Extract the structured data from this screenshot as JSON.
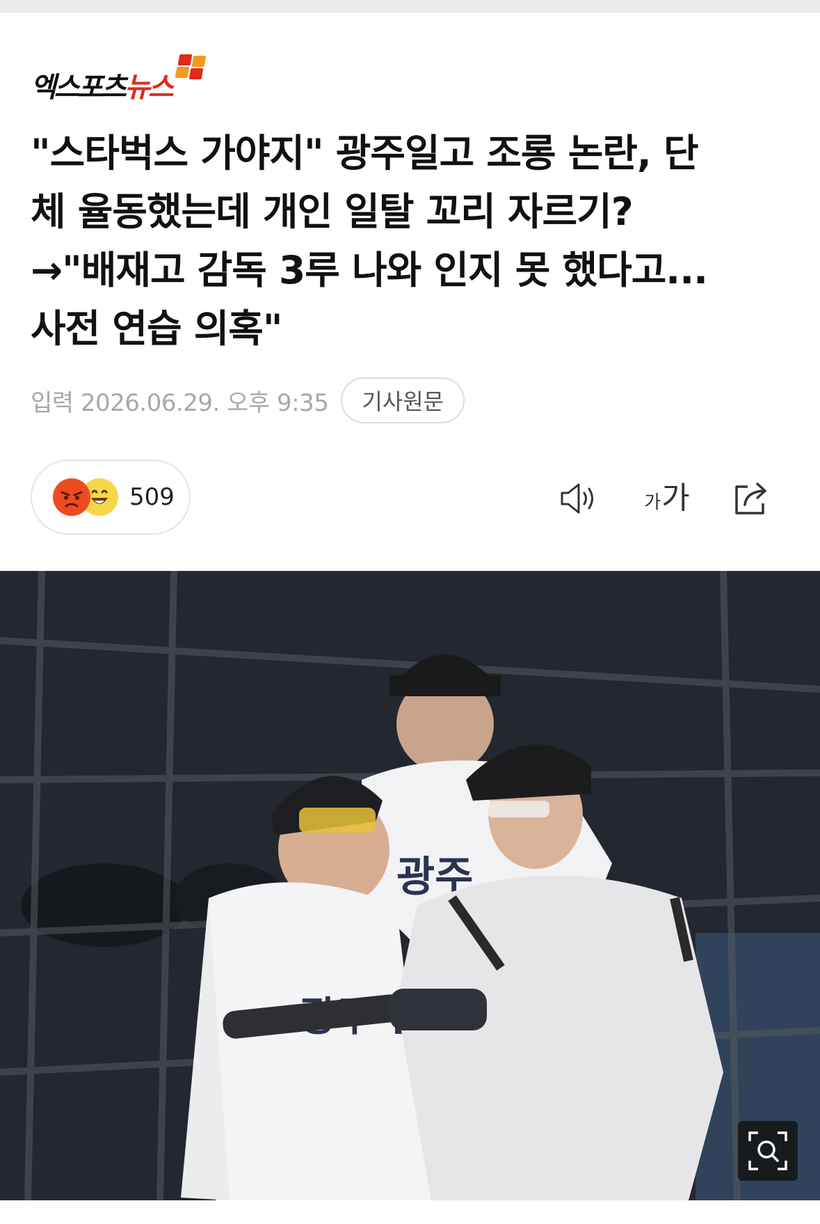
{
  "brand": {
    "logo_text_black": "엑스포츠",
    "logo_text_red": "뉴스",
    "logo_colors": [
      "#e02a1c",
      "#f39a1e"
    ]
  },
  "article": {
    "headline_lines": [
      "\"스타벅스 가야지\" 광주일고 조롱 논란, 단",
      "체 율동했는데 개인 일탈 꼬리 자르기?",
      "→\"배재고 감독 3루 나와 인지 못 했다고...",
      "사전 연습 의혹\""
    ],
    "published": "입력 2026.06.29. 오후 9:35",
    "original_button": "기사원문"
  },
  "reactions": {
    "count": "509",
    "emojis": [
      "angry-emoji",
      "grinning-emoji"
    ]
  },
  "toolbar": {
    "audio_icon": "speaker-icon",
    "font_size_small": "가",
    "font_size_large": "가",
    "share_icon": "share-icon"
  },
  "photo": {
    "jersey_text_1": "광주",
    "jersey_text_2": "광주 일",
    "zoom_icon": "zoom-icon"
  }
}
